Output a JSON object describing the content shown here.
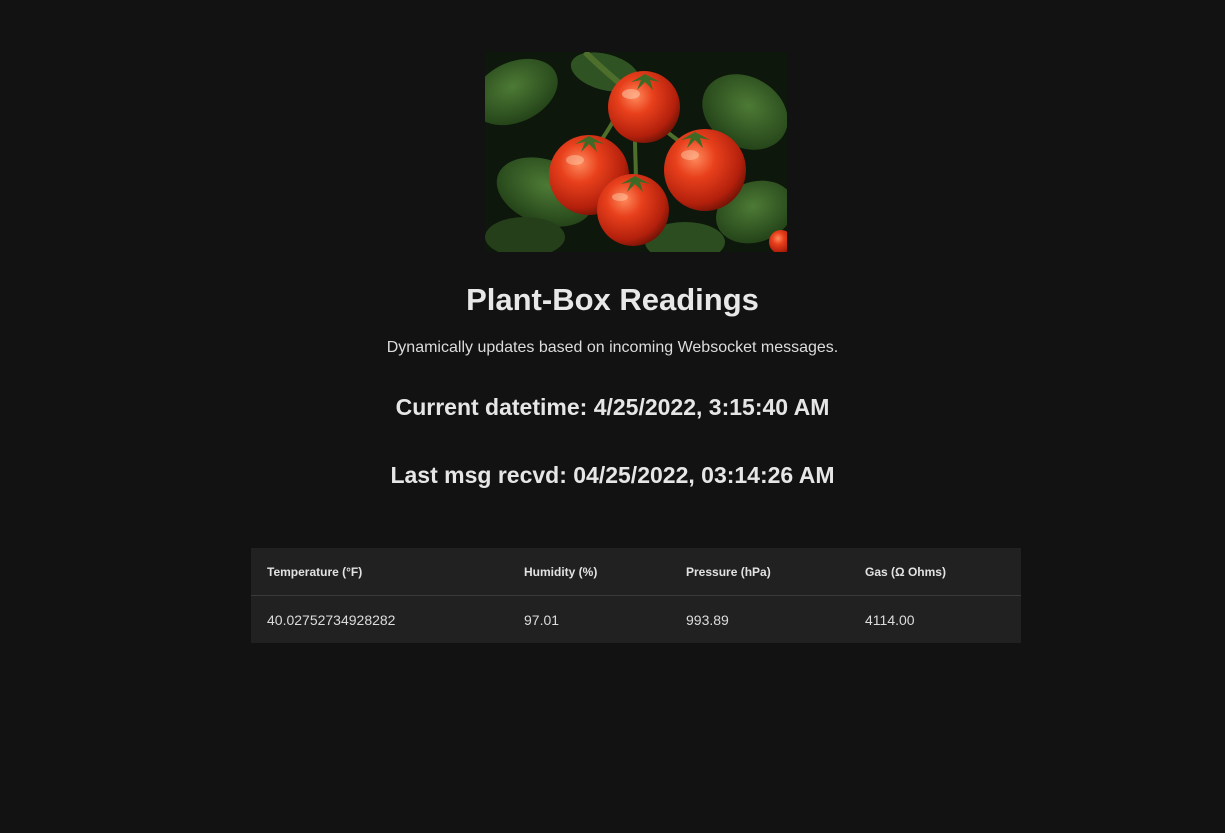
{
  "header": {
    "title": "Plant-Box Readings",
    "subtitle": "Dynamically updates based on incoming Websocket messages."
  },
  "status": {
    "current_datetime": "Current datetime: 4/25/2022, 3:15:40 AM",
    "last_msg": "Last msg recvd: 04/25/2022, 03:14:26 AM"
  },
  "table": {
    "columns": [
      "Temperature (°F)",
      "Humidity (%)",
      "Pressure (hPa)",
      "Gas (Ω Ohms)"
    ],
    "rows": [
      [
        "40.02752734928282",
        "97.01",
        "993.89",
        "4114.00"
      ]
    ]
  },
  "colors": {
    "background": "#121212",
    "table_bg": "#212121",
    "text": "#e6e6e6"
  },
  "image": {
    "subject": "tomatoes-on-vine"
  }
}
